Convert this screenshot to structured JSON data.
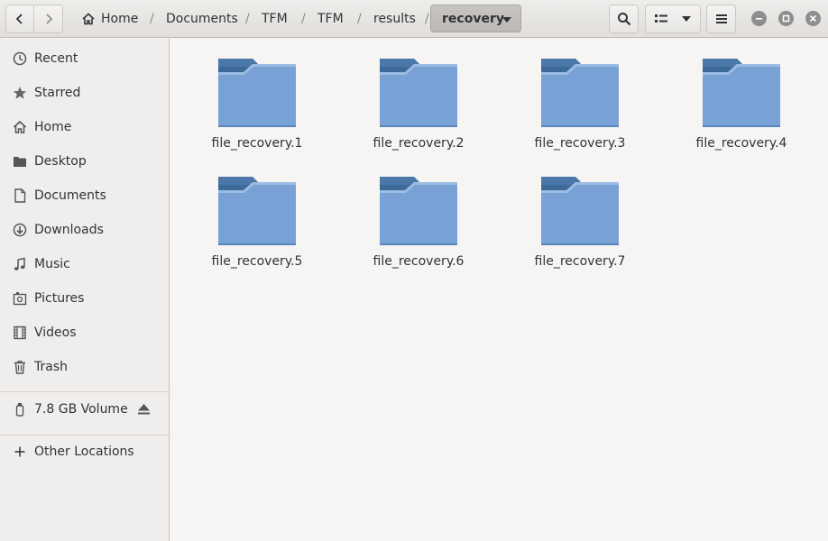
{
  "header": {
    "back_icon": "go-previous-icon",
    "forward_icon": "go-next-icon",
    "breadcrumbs": [
      "Home",
      "Documents",
      "TFM",
      "TFM",
      "results"
    ],
    "current_folder": "recovery",
    "search_icon": "search-icon",
    "view_icon": "list-view-icon",
    "menu_icon": "hamburger-menu-icon"
  },
  "sidebar": {
    "items": [
      {
        "label": "Recent",
        "icon": "clock-icon"
      },
      {
        "label": "Starred",
        "icon": "star-icon"
      },
      {
        "label": "Home",
        "icon": "home-icon"
      },
      {
        "label": "Desktop",
        "icon": "folder-icon"
      },
      {
        "label": "Documents",
        "icon": "document-icon"
      },
      {
        "label": "Downloads",
        "icon": "download-icon"
      },
      {
        "label": "Music",
        "icon": "music-icon"
      },
      {
        "label": "Pictures",
        "icon": "pictures-icon"
      },
      {
        "label": "Videos",
        "icon": "film-icon"
      },
      {
        "label": "Trash",
        "icon": "trash-icon"
      }
    ],
    "volume": {
      "label": "7.8 GB Volume",
      "icon": "usb-drive-icon",
      "action_icon": "eject-icon"
    },
    "other": {
      "label": "Other Locations",
      "icon": "plus-icon"
    }
  },
  "files": [
    {
      "name": "file_recovery.1"
    },
    {
      "name": "file_recovery.2"
    },
    {
      "name": "file_recovery.3"
    },
    {
      "name": "file_recovery.4"
    },
    {
      "name": "file_recovery.5"
    },
    {
      "name": "file_recovery.6"
    },
    {
      "name": "file_recovery.7"
    }
  ],
  "colors": {
    "folder_front": "#6f9bd1",
    "folder_back": "#3d6a99",
    "sidebar_bg": "#f0eeec",
    "main_bg": "#f6f5f4"
  }
}
